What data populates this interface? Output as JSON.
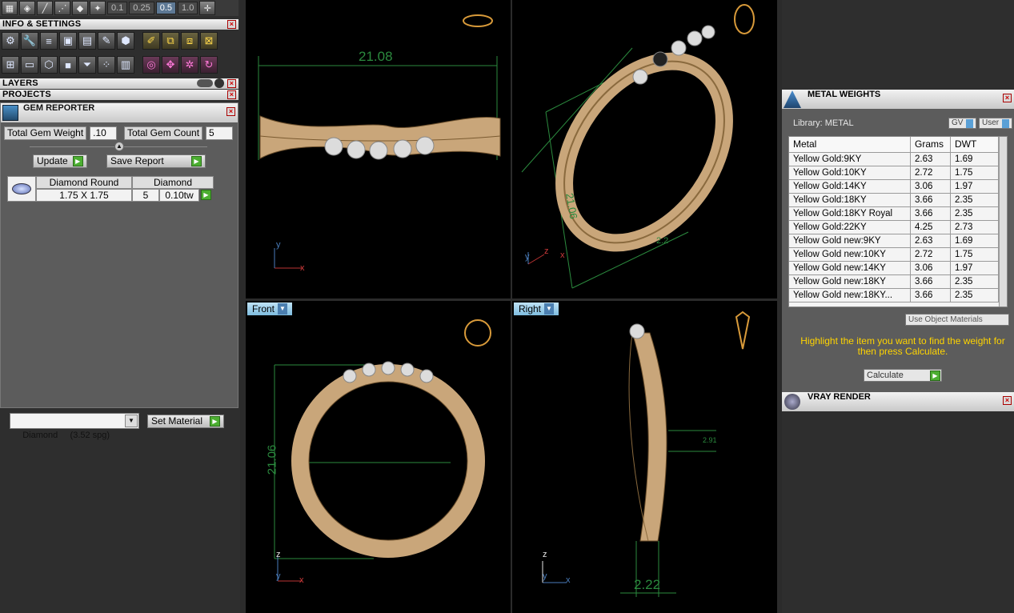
{
  "toolbar": {
    "zoom_values": [
      "0.1",
      "0.25",
      "0.5",
      "1.0"
    ],
    "active_zoom": "0.5"
  },
  "left": {
    "info_title": "INFO & SETTINGS",
    "layers_title": "LAYERS",
    "projects_title": "PROJECTS",
    "gem_reporter": {
      "title": "GEM REPORTER",
      "total_weight_label": "Total Gem Weight",
      "total_weight_value": ".10",
      "total_count_label": "Total Gem Count",
      "total_count_value": "5",
      "update_label": "Update",
      "save_report_label": "Save Report",
      "gem": {
        "shape": "Diamond Round",
        "material": "Diamond",
        "size": "1.75 X 1.75",
        "count": "5",
        "weight": "0.10tw"
      }
    },
    "material_select": "Diamond     (3.52 spg)",
    "set_material_label": "Set Material"
  },
  "viewports": {
    "top_left": {
      "dimension": "21.08",
      "axis_y": "y",
      "axis_x": "x"
    },
    "top_right": {
      "dimension": "21.06",
      "dimension_small": "2.2",
      "axis_z": "z",
      "axis_y": "y",
      "axis_x": "x"
    },
    "bottom_left": {
      "label": "Front",
      "dimension": "21.06",
      "axis_z": "z",
      "axis_y": "y",
      "axis_x": "x"
    },
    "bottom_right": {
      "label": "Right",
      "dimension": "2.22",
      "dimension_small": "2.91",
      "axis_z": "z",
      "axis_y": "y",
      "axis_x": "x"
    }
  },
  "right": {
    "metal_weights": {
      "title": "METAL WEIGHTS",
      "library": "Library: METAL",
      "toggle_gv": "GV",
      "toggle_user": "User",
      "columns": [
        "Metal",
        "Grams",
        "DWT"
      ],
      "rows": [
        [
          "Yellow Gold:9KY",
          "2.63",
          "1.69"
        ],
        [
          "Yellow Gold:10KY",
          "2.72",
          "1.75"
        ],
        [
          "Yellow Gold:14KY",
          "3.06",
          "1.97"
        ],
        [
          "Yellow Gold:18KY",
          "3.66",
          "2.35"
        ],
        [
          "Yellow Gold:18KY Royal",
          "3.66",
          "2.35"
        ],
        [
          "Yellow Gold:22KY",
          "4.25",
          "2.73"
        ],
        [
          "Yellow Gold new:9KY",
          "2.63",
          "1.69"
        ],
        [
          "Yellow Gold new:10KY",
          "2.72",
          "1.75"
        ],
        [
          "Yellow Gold new:14KY",
          "3.06",
          "1.97"
        ],
        [
          "Yellow Gold new:18KY",
          "3.66",
          "2.35"
        ],
        [
          "Yellow Gold new:18KY...",
          "3.66",
          "2.35"
        ]
      ],
      "use_object_materials": "Use Object Materials",
      "hint": "Highlight the item you want to find the weight for then press Calculate.",
      "calculate_label": "Calculate"
    },
    "vray_title": "VRAY RENDER"
  },
  "colors": {
    "gold": "#c9a67a",
    "dimension_green": "#2b8a3e",
    "hint_yellow": "#ffd400"
  }
}
